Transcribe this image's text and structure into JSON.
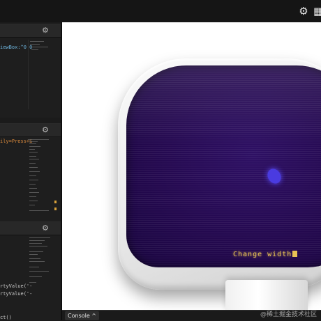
{
  "topbar": {
    "settings_icon": "gear-icon",
    "layout_icon": "layout-icon"
  },
  "panels": [
    {
      "gear_icon": "gear-icon",
      "code_lines": [
        {
          "text": "iewBox:^0 0",
          "color": "#6fb7e0"
        }
      ]
    },
    {
      "gear_icon": "gear-icon",
      "code_lines": [
        {
          "text": "ily=Press+S",
          "color": "#d8893c"
        }
      ]
    },
    {
      "gear_icon": "gear-icon",
      "code_lines": [
        {
          "text": "rtyValue('-",
          "color": "#c8c8c8"
        },
        {
          "text": "rtyValue('-",
          "color": "#c8c8c8"
        },
        {
          "text": "ct()",
          "color": "#c8c8c8"
        }
      ]
    }
  ],
  "preview": {
    "screen_text": "Change width",
    "screen_color": "#24094f",
    "text_color": "#e8c254"
  },
  "console": {
    "label": "Console ^"
  },
  "watermark": "@稀土掘金技术社区"
}
